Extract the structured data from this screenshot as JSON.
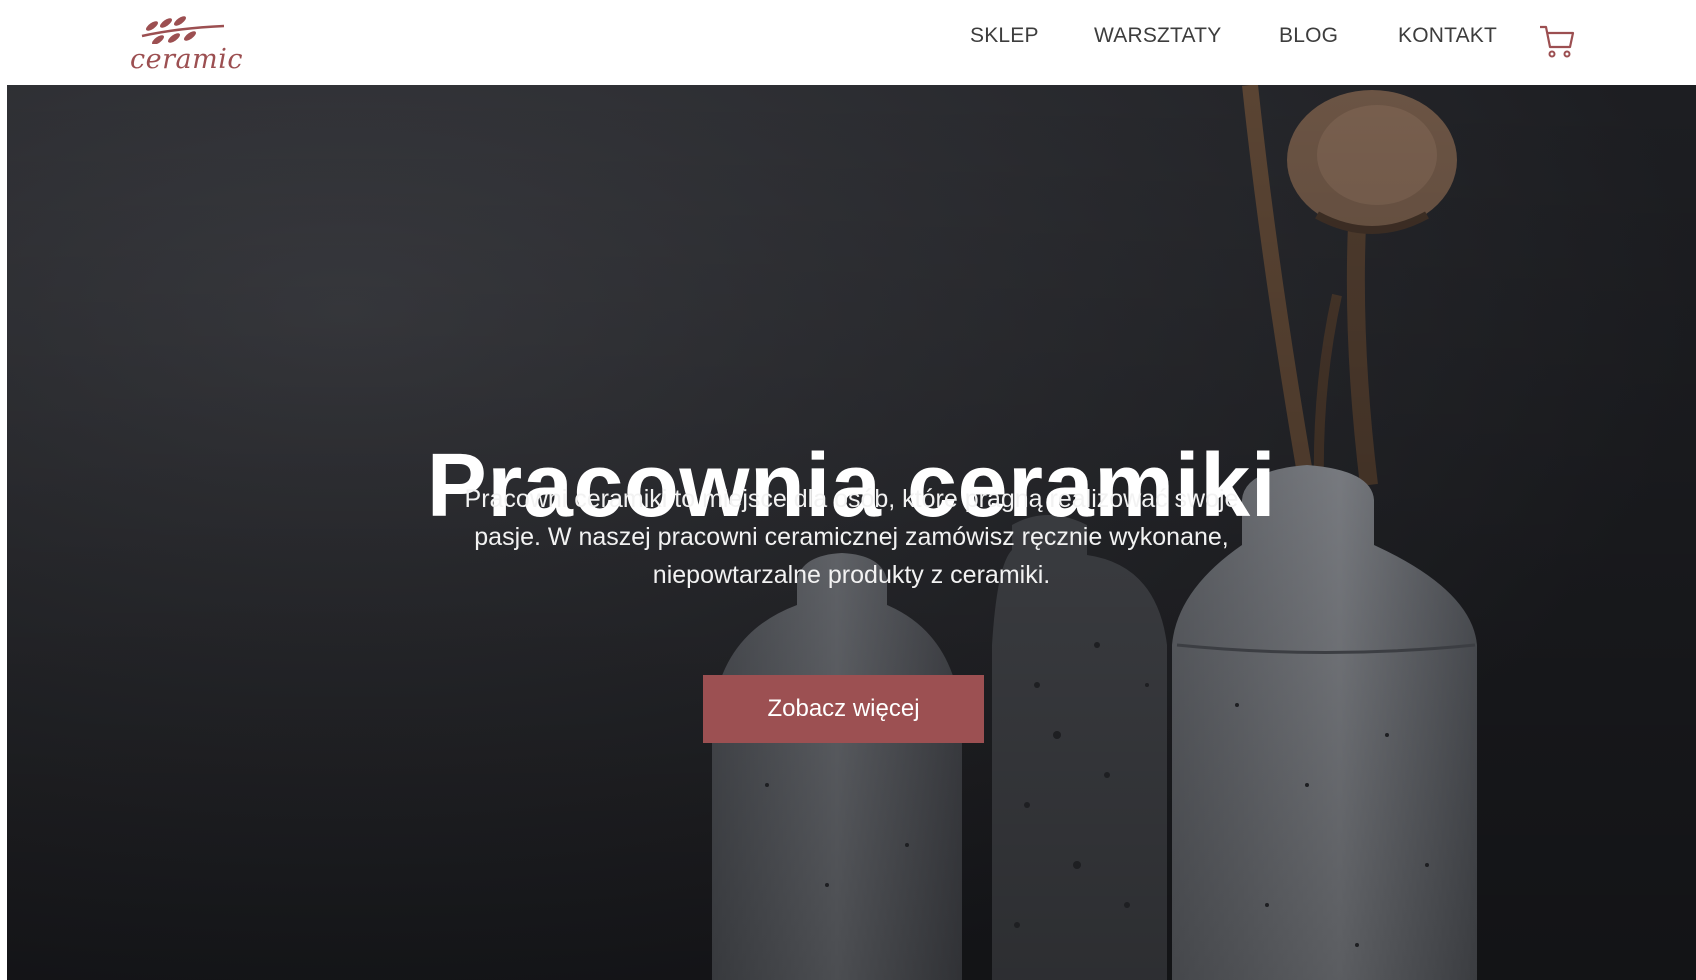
{
  "brand": {
    "logo_text": "ceramic",
    "logo_icon": "leaf-branch-icon",
    "color": "#9c4f51"
  },
  "nav": {
    "items": [
      {
        "label": "SKLEP"
      },
      {
        "label": "WARSZTATY"
      },
      {
        "label": "BLOG"
      },
      {
        "label": "KONTAKT"
      }
    ],
    "cart_icon": "shopping-cart-icon"
  },
  "hero": {
    "title": "Pracownia ceramiki",
    "description": "Pracowni ceramiki to miejsce dla osób, które pragną realizować swoje pasje. W naszej pracowni ceramicznej zamówisz ręcznie wykonane, niepowtarzalne produkty z ceramiki.",
    "cta_label": "Zobacz więcej",
    "cta_color": "#9c5052",
    "background_color": "#2a2b30"
  }
}
